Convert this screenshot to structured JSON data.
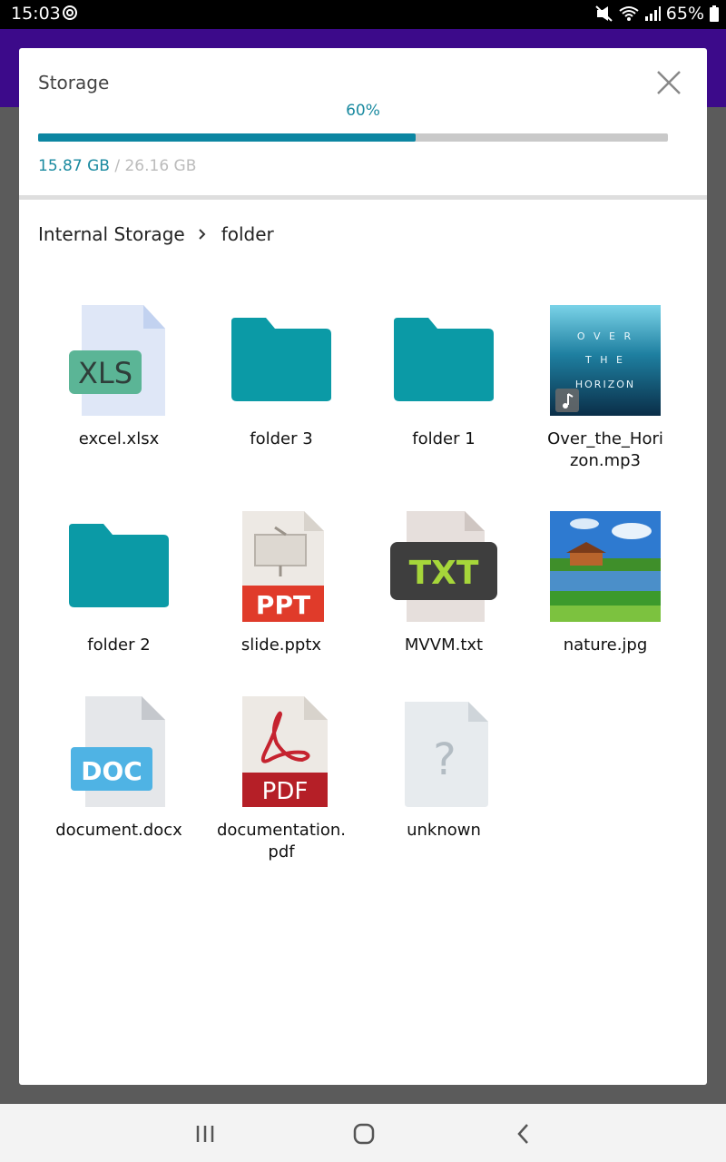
{
  "status_bar": {
    "time": "15:03",
    "battery": "65%"
  },
  "dialog": {
    "title": "Storage",
    "percent_label": "60%",
    "progress_fraction": 0.6,
    "used": "15.87 GB",
    "separator": "/",
    "total": "26.16 GB",
    "breadcrumb": [
      "Internal Storage",
      "folder"
    ]
  },
  "files": [
    {
      "name": "excel.xlsx",
      "icon": "xls-file-icon"
    },
    {
      "name": "folder 3",
      "icon": "folder-icon"
    },
    {
      "name": "folder 1",
      "icon": "folder-icon"
    },
    {
      "name": "Over_the_Hori zon.mp3",
      "icon": "audio-thumbnail"
    },
    {
      "name": "folder 2",
      "icon": "folder-icon"
    },
    {
      "name": "slide.pptx",
      "icon": "ppt-file-icon"
    },
    {
      "name": "MVVM.txt",
      "icon": "txt-file-icon"
    },
    {
      "name": "nature.jpg",
      "icon": "image-thumbnail"
    },
    {
      "name": "document.docx",
      "icon": "doc-file-icon"
    },
    {
      "name": "documentation. pdf",
      "icon": "pdf-file-icon"
    },
    {
      "name": "unknown",
      "icon": "unknown-file-icon"
    }
  ],
  "thumbnails": {
    "mp3_text": "O V E R T H E H O R I Z O N"
  },
  "colors": {
    "accent": "#0c86a2",
    "folder": "#0b9aa6",
    "header": "#3c0a8a"
  }
}
